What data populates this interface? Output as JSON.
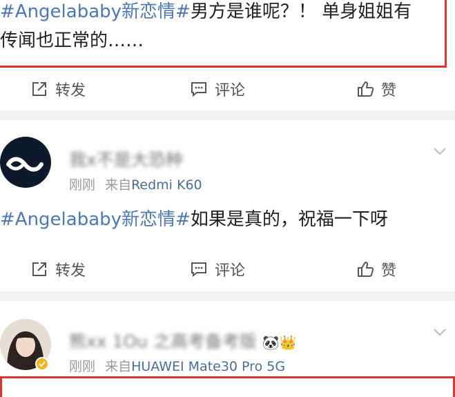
{
  "post1": {
    "hashtag": "#Angelababy新恋情#",
    "text_line1": "男方是谁呢？！ 单身姐姐有",
    "text_line2": "传闻也正常的……"
  },
  "actions": {
    "repost": "转发",
    "comment": "评论",
    "like": "赞"
  },
  "post2": {
    "username": "我ⅹ不是大恐种",
    "time": "刚刚",
    "from_label": "来自",
    "device": "Redmi K60",
    "hashtag": "#Angelababy新恋情#",
    "text": "如果是真的，祝福一下呀"
  },
  "post3": {
    "username": "熊ⅹⅹ 1Ou 之高考备考版",
    "time": "刚刚",
    "from_label": "来自",
    "device": "HUAWEI Mate30 Pro 5G"
  },
  "colors": {
    "hashtag": "#4a78b8",
    "highlight": "#e0322f",
    "separator": "#f2f2f2",
    "verified_badge": "#f5b324"
  }
}
